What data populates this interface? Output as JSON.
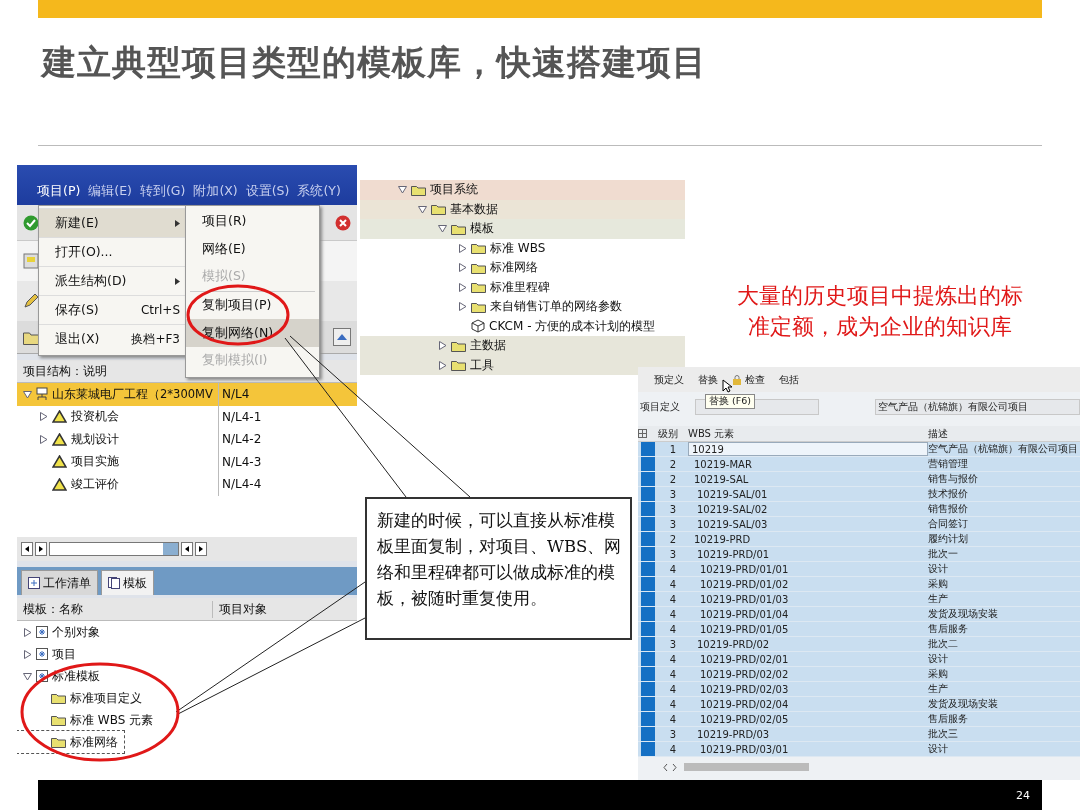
{
  "slide": {
    "title": "建立典型项目类型的模板库，快速搭建项目",
    "page_number": "24"
  },
  "project_builder": {
    "menubar": [
      "项目(P)",
      "编辑(E)",
      "转到(G)",
      "附加(X)",
      "设置(S)",
      "系统(Y)"
    ],
    "menu": [
      {
        "label": "新建(E)",
        "has_submenu": true,
        "selected": true
      },
      {
        "label": "打开(O)...",
        "has_submenu": false,
        "selected": false
      },
      {
        "label": "派生结构(D)",
        "has_submenu": true,
        "selected": false
      },
      {
        "label": "保存(S)",
        "shortcut": "Ctrl+S",
        "has_submenu": false,
        "selected": false
      },
      {
        "label": "退出(X)",
        "shortcut": "换档+F3",
        "has_submenu": false,
        "selected": false
      }
    ],
    "submenu": [
      {
        "label": "项目(R)",
        "disabled": false,
        "selected": false
      },
      {
        "label": "网络(E)",
        "disabled": false,
        "selected": false
      },
      {
        "label": "模拟(S)",
        "disabled": true,
        "selected": false
      },
      {
        "label": "复制项目(P)",
        "disabled": false,
        "selected": false
      },
      {
        "label": "复制网络(N)",
        "disabled": false,
        "selected": true
      },
      {
        "label": "复制模拟(I)",
        "disabled": true,
        "selected": false
      }
    ],
    "structure_header": "项目结构：说明",
    "structure": [
      {
        "label": "山东莱城电厂工程（2*300MV",
        "code": "N/L4",
        "kind": "project",
        "expanded": true,
        "selected": true,
        "children": [
          {
            "label": "投资机会",
            "code": "N/L4-1",
            "kind": "node",
            "expanded": false,
            "selected": false
          },
          {
            "label": "规划设计",
            "code": "N/L4-2",
            "kind": "node",
            "expanded": false,
            "selected": false
          },
          {
            "label": "项目实施",
            "code": "N/L4-3",
            "kind": "leaf",
            "selected": false
          },
          {
            "label": "竣工评价",
            "code": "N/L4-4",
            "kind": "leaf",
            "selected": false
          }
        ]
      }
    ],
    "tabs": [
      {
        "label": "工作清单",
        "selected": false
      },
      {
        "label": "模板",
        "selected": true
      }
    ],
    "template_columns": [
      "模板：名称",
      "项目对象"
    ],
    "templates": [
      {
        "label": "个别对象",
        "kind": "node",
        "expanded": false,
        "selected": false
      },
      {
        "label": "项目",
        "kind": "node",
        "expanded": false,
        "selected": false
      },
      {
        "label": "标准模板",
        "kind": "node",
        "expanded": true,
        "selected": false,
        "children": [
          {
            "label": "标准项目定义",
            "kind": "folder",
            "selected": false
          },
          {
            "label": "标准 WBS 元素",
            "kind": "folder",
            "selected": false
          },
          {
            "label": "标准网络",
            "kind": "folder",
            "selected": true
          }
        ]
      }
    ]
  },
  "structure_tree": [
    {
      "label": "项目系统",
      "kind": "folder",
      "expanded": true,
      "children": [
        {
          "label": "基本数据",
          "kind": "folder",
          "expanded": true,
          "children": [
            {
              "label": "模板",
              "kind": "folder",
              "expanded": true,
              "children": [
                {
                  "label": "标准 WBS",
                  "kind": "folder",
                  "expanded": false
                },
                {
                  "label": "标准网络",
                  "kind": "folder",
                  "expanded": false
                },
                {
                  "label": "标准里程碑",
                  "kind": "folder",
                  "expanded": false
                },
                {
                  "label": "来自销售订单的网络参数",
                  "kind": "folder",
                  "expanded": false
                },
                {
                  "label": "CKCM - 方便的成本计划的模型",
                  "kind": "model"
                }
              ]
            },
            {
              "label": "主数据",
              "kind": "folder",
              "expanded": false
            },
            {
              "label": "工具",
              "kind": "folder",
              "expanded": false
            }
          ]
        }
      ]
    }
  ],
  "annotation": [
    "大量的历史项目中提炼出的标",
    "准定额，成为企业的知识库"
  ],
  "callout": "新建的时候，可以直接从标准模板里面复制，对项目、WBS、网络和里程碑都可以做成标准的模板，被随时重复使用。",
  "wbs_editor": {
    "toolbar": [
      {
        "label": "预定义",
        "kind": "text"
      },
      {
        "label": "替换",
        "kind": "text"
      },
      {
        "label": "检查",
        "kind": "lock"
      },
      {
        "label": "包括",
        "kind": "text"
      }
    ],
    "tooltip": "替换 (F6)",
    "project_label": "项目定义",
    "project_description": "空气产品（杭锦旗）有限公司项目",
    "columns": [
      "级别",
      "WBS 元素",
      "描述"
    ],
    "rows": [
      {
        "level": "1",
        "wbs": "10219",
        "description": "空气产品（杭锦旗）有限公司项目",
        "selected": true
      },
      {
        "level": "2",
        "wbs": "10219-MAR",
        "description": "营销管理",
        "selected": true
      },
      {
        "level": "2",
        "wbs": "10219-SAL",
        "description": "销售与报价",
        "selected": true
      },
      {
        "level": "3",
        "wbs": "10219-SAL/01",
        "description": "技术报价",
        "selected": true
      },
      {
        "level": "3",
        "wbs": "10219-SAL/02",
        "description": "销售报价",
        "selected": true
      },
      {
        "level": "3",
        "wbs": "10219-SAL/03",
        "description": "合同签订",
        "selected": true
      },
      {
        "level": "2",
        "wbs": "10219-PRD",
        "description": "履约计划",
        "selected": true
      },
      {
        "level": "3",
        "wbs": "10219-PRD/01",
        "description": "批次一",
        "selected": true
      },
      {
        "level": "4",
        "wbs": "10219-PRD/01/01",
        "description": "设计",
        "selected": true
      },
      {
        "level": "4",
        "wbs": "10219-PRD/01/02",
        "description": "采购",
        "selected": true
      },
      {
        "level": "4",
        "wbs": "10219-PRD/01/03",
        "description": "生产",
        "selected": true
      },
      {
        "level": "4",
        "wbs": "10219-PRD/01/04",
        "description": "发货及现场安装",
        "selected": true
      },
      {
        "level": "4",
        "wbs": "10219-PRD/01/05",
        "description": "售后服务",
        "selected": true
      },
      {
        "level": "3",
        "wbs": "10219-PRD/02",
        "description": "批次二",
        "selected": true
      },
      {
        "level": "4",
        "wbs": "10219-PRD/02/01",
        "description": "设计",
        "selected": true
      },
      {
        "level": "4",
        "wbs": "10219-PRD/02/02",
        "description": "采购",
        "selected": true
      },
      {
        "level": "4",
        "wbs": "10219-PRD/02/03",
        "description": "生产",
        "selected": true
      },
      {
        "level": "4",
        "wbs": "10219-PRD/02/04",
        "description": "发货及现场安装",
        "selected": true
      },
      {
        "level": "4",
        "wbs": "10219-PRD/02/05",
        "description": "售后服务",
        "selected": true
      },
      {
        "level": "3",
        "wbs": "10219-PRD/03",
        "description": "批次三",
        "selected": true
      },
      {
        "level": "4",
        "wbs": "10219-PRD/03/01",
        "description": "设计",
        "selected": true
      }
    ]
  }
}
